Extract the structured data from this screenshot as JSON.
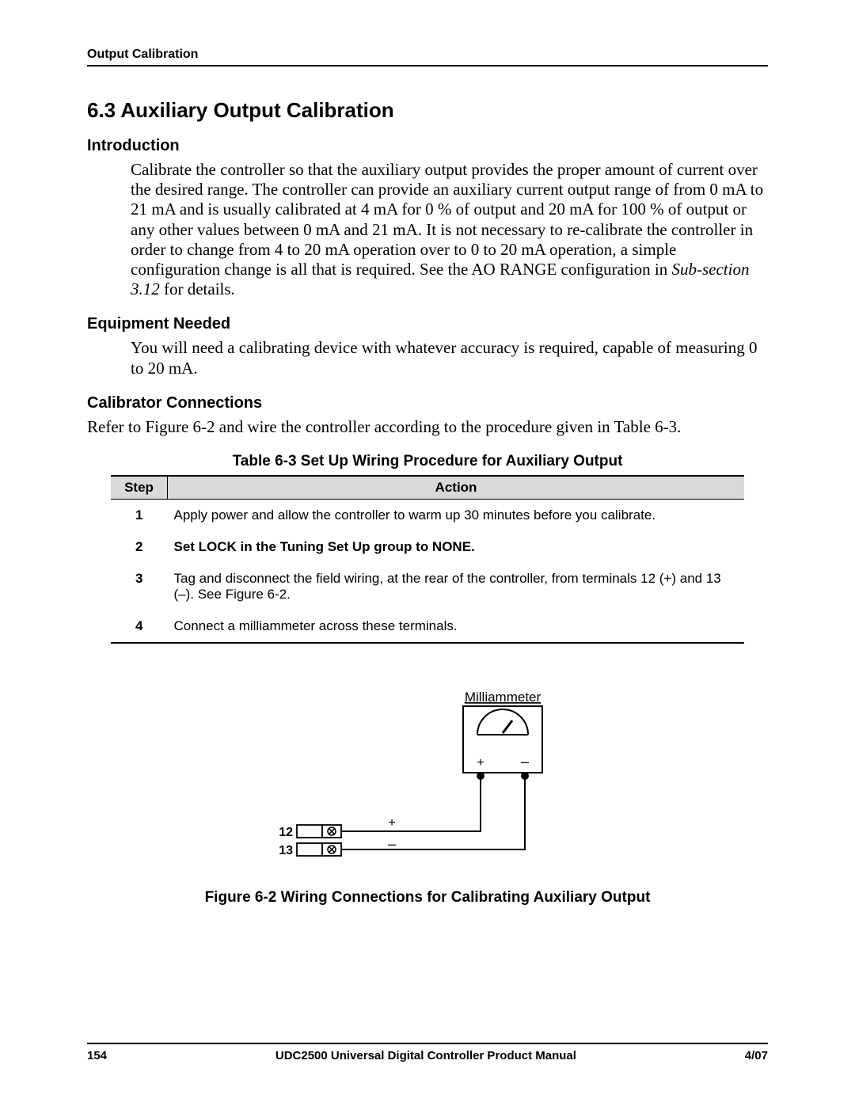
{
  "header": {
    "running": "Output Calibration"
  },
  "section": {
    "number_title": "6.3  Auxiliary Output Calibration"
  },
  "intro": {
    "heading": "Introduction",
    "para_a": "Calibrate the controller so that the auxiliary output provides the proper amount of current over the desired range. The controller can provide an auxiliary current output range of from 0 mA to 21 mA and is usually calibrated at 4 mA for 0 % of output and 20 mA for 100 % of output or any other values between 0 mA and 21 mA.  It is not necessary to re-calibrate the controller in order to change from 4 to 20 mA operation over to 0 to 20 mA operation, a simple configuration change is all that is required.  See the AO RANGE configuration in ",
    "para_italic": "Sub-section 3.12",
    "para_b": " for details."
  },
  "equip": {
    "heading": "Equipment Needed",
    "para": "You will need a calibrating device with whatever accuracy is required, capable of measuring 0 to 20 mA."
  },
  "conn": {
    "heading": "Calibrator Connections",
    "para": "Refer to Figure 6-2 and wire the controller according to the procedure given in Table 6-3."
  },
  "table": {
    "caption": "Table 6-3  Set Up Wiring Procedure for Auxiliary Output",
    "col_step": "Step",
    "col_action": "Action",
    "rows": [
      {
        "step": "1",
        "action": "Apply power and allow the controller to warm up 30 minutes before you calibrate.",
        "bold": false
      },
      {
        "step": "2",
        "action": "Set LOCK in the Tuning Set Up group to NONE.",
        "bold": true
      },
      {
        "step": "3",
        "action": "Tag and disconnect the field wiring, at the rear of the controller, from terminals 12 (+) and 13 (–). See Figure 6-2.",
        "bold": false
      },
      {
        "step": "4",
        "action": "Connect a milliammeter across these terminals.",
        "bold": false
      }
    ]
  },
  "figure": {
    "caption": "Figure 6-2  Wiring Connections for Calibrating Auxiliary Output",
    "meter_label": "Milliammeter",
    "plus": "+",
    "minus": "–",
    "term12": "12",
    "term13": "13"
  },
  "footer": {
    "page": "154",
    "title": "UDC2500 Universal Digital Controller Product Manual",
    "date": "4/07"
  }
}
